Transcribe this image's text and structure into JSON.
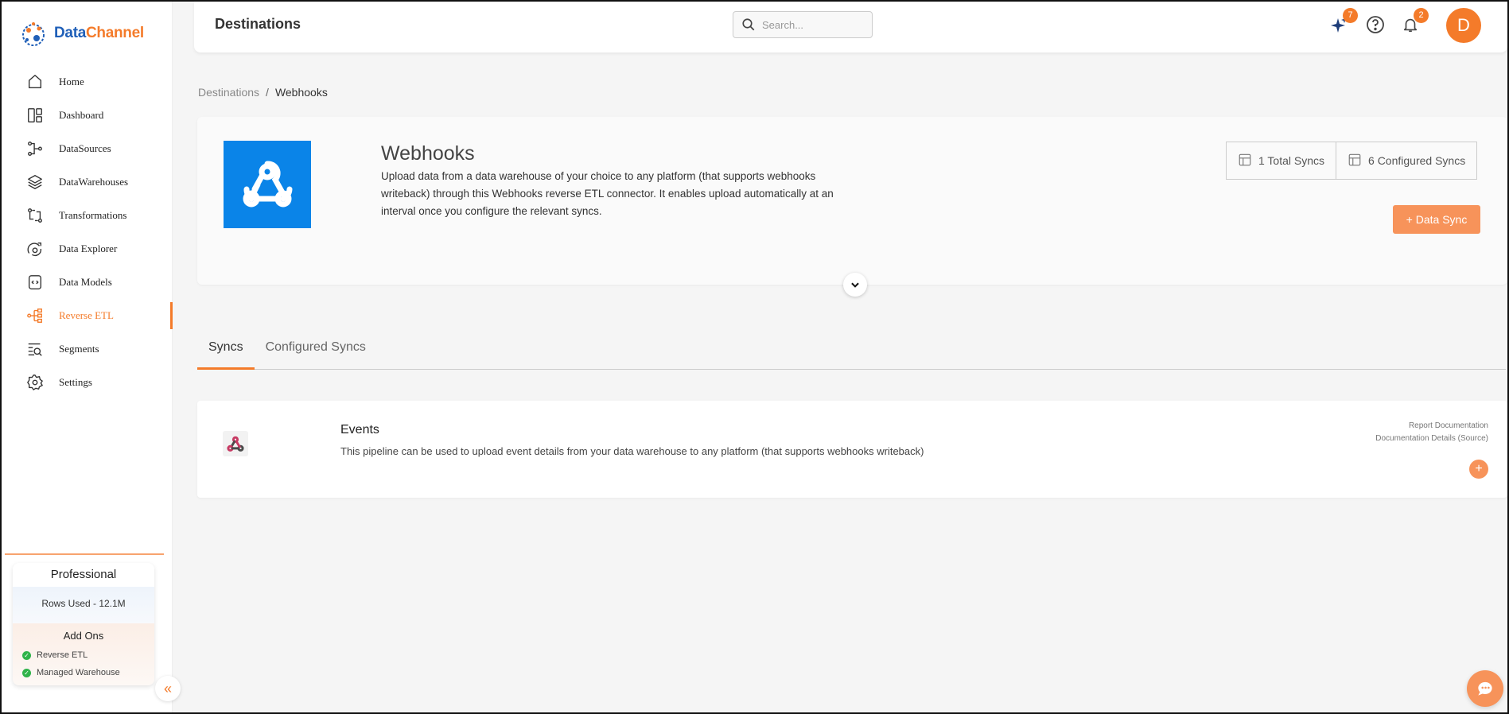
{
  "brand": {
    "name_part1": "Data",
    "name_part2": "Channel",
    "accent": "#f47b2a",
    "blue": "#1f5fb8"
  },
  "sidebar": {
    "items": [
      {
        "label": "Home",
        "icon": "home-icon"
      },
      {
        "label": "Dashboard",
        "icon": "dashboard-icon"
      },
      {
        "label": "DataSources",
        "icon": "datasources-icon"
      },
      {
        "label": "DataWarehouses",
        "icon": "layers-icon"
      },
      {
        "label": "Transformations",
        "icon": "transform-icon"
      },
      {
        "label": "Data Explorer",
        "icon": "explorer-icon"
      },
      {
        "label": "Data Models",
        "icon": "models-icon"
      },
      {
        "label": "Reverse ETL",
        "icon": "reverse-etl-icon",
        "active": true
      },
      {
        "label": "Segments",
        "icon": "segments-icon"
      },
      {
        "label": "Settings",
        "icon": "gear-icon"
      }
    ],
    "plan": {
      "title": "Professional",
      "rows_used": "Rows Used - 12.1M",
      "addons_title": "Add Ons",
      "addons": [
        "Reverse ETL",
        "Managed Warehouse"
      ]
    }
  },
  "header": {
    "title": "Destinations",
    "search_placeholder": "Search...",
    "sparkle_badge": "7",
    "notification_badge": "2",
    "avatar_letter": "D"
  },
  "breadcrumb": {
    "parent": "Destinations",
    "separator": "/",
    "current": "Webhooks"
  },
  "hero": {
    "title": "Webhooks",
    "description": "Upload data from a data warehouse of your choice to any platform (that supports webhooks writeback) through this Webhooks reverse ETL connector. It enables upload automatically at an interval once you configure the relevant syncs.",
    "total_syncs": "1 Total Syncs",
    "configured_syncs": "6 Configured Syncs",
    "add_button": "+ Data Sync",
    "logo_color": "#0a84e8"
  },
  "tabs": [
    {
      "label": "Syncs",
      "active": true
    },
    {
      "label": "Configured Syncs",
      "active": false
    }
  ],
  "sync": {
    "title": "Events",
    "description": "This pipeline can be used to upload event details from your data warehouse to any platform (that supports webhooks writeback)",
    "link1": "Report Documentation",
    "link2": "Documentation Details (Source)",
    "add_symbol": "+"
  }
}
